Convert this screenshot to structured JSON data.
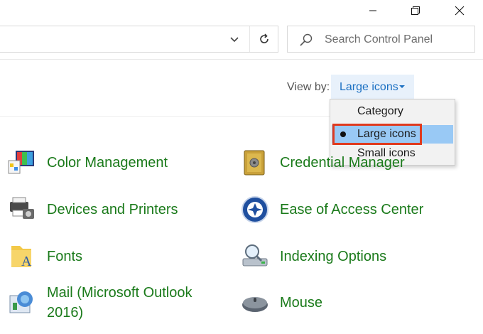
{
  "window": {
    "minimize_icon": "minimize-icon",
    "maximize_icon": "restore-icon",
    "close_icon": "close-icon"
  },
  "search": {
    "placeholder": "Search Control Panel"
  },
  "view_by": {
    "label": "View by:",
    "value": "Large icons",
    "options": [
      {
        "label": "Category",
        "selected": false
      },
      {
        "label": "Large icons",
        "selected": true
      },
      {
        "label": "Small icons",
        "selected": false
      }
    ]
  },
  "items": [
    {
      "label": "Color Management",
      "icon": "color-management-icon"
    },
    {
      "label": "Credential Manager",
      "icon": "credential-manager-icon"
    },
    {
      "label": "Devices and Printers",
      "icon": "devices-printers-icon"
    },
    {
      "label": "Ease of Access Center",
      "icon": "ease-of-access-icon"
    },
    {
      "label": "Fonts",
      "icon": "fonts-icon"
    },
    {
      "label": "Indexing Options",
      "icon": "indexing-options-icon"
    },
    {
      "label": "Mail (Microsoft Outlook 2016)",
      "icon": "mail-icon"
    },
    {
      "label": "Mouse",
      "icon": "mouse-icon"
    }
  ],
  "colors": {
    "link_green": "#1a7a1a",
    "accent_blue": "#1a6fc2",
    "highlight_red": "#e03a1e",
    "menu_selected": "#99c9f5"
  }
}
